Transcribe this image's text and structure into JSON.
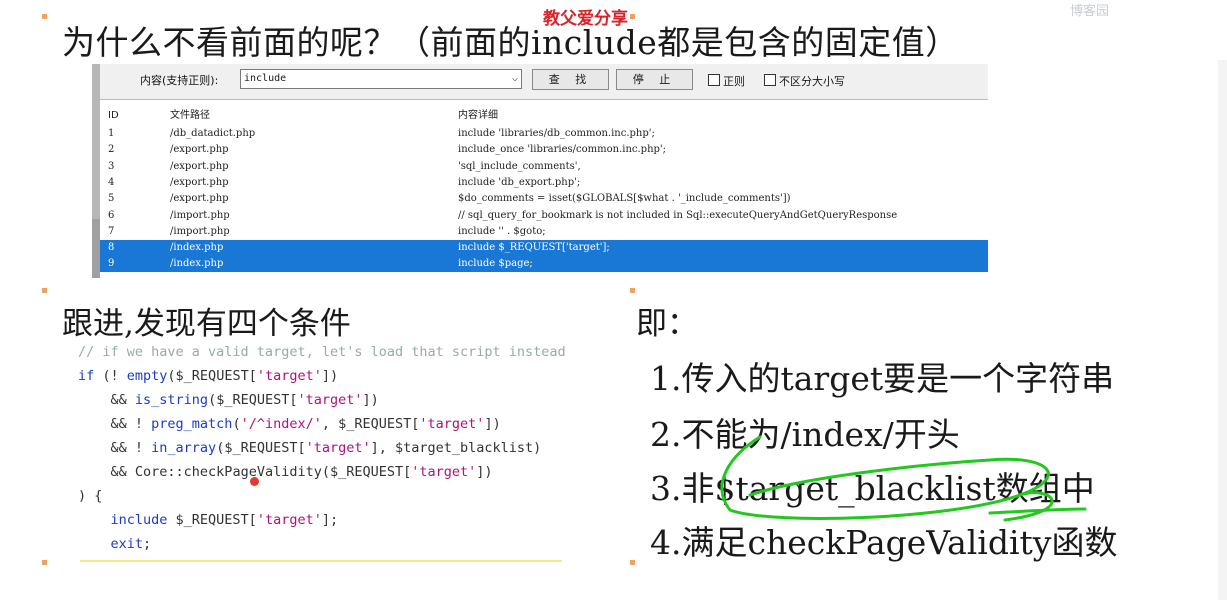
{
  "watermark": "教父爱分享",
  "logo": "博客园",
  "heading": "为什么不看前面的呢？（前面的include都是包含的固定值）",
  "search_tool": {
    "content_label": "内容(支持正则):",
    "query_value": "include",
    "find_button": "查 找",
    "stop_button": "停 止",
    "regex_checkbox": "正则",
    "case_checkbox": "不区分大小写",
    "columns": [
      "ID",
      "文件路径",
      "内容详细"
    ],
    "rows": [
      {
        "id": "1",
        "path": "/db_datadict.php",
        "detail": "include 'libraries/db_common.inc.php';"
      },
      {
        "id": "2",
        "path": "/export.php",
        "detail": "include_once 'libraries/common.inc.php';"
      },
      {
        "id": "3",
        "path": "/export.php",
        "detail": "'sql_include_comments',"
      },
      {
        "id": "4",
        "path": "/export.php",
        "detail": "include 'db_export.php';"
      },
      {
        "id": "5",
        "path": "/export.php",
        "detail": "$do_comments = isset($GLOBALS[$what . '_include_comments'])"
      },
      {
        "id": "6",
        "path": "/import.php",
        "detail": "// sql_query_for_bookmark is not included in Sql::executeQueryAndGetQueryResponse"
      },
      {
        "id": "7",
        "path": "/import.php",
        "detail": "include '' . $goto;"
      },
      {
        "id": "8",
        "path": "/index.php",
        "detail": "include $_REQUEST['target'];",
        "selected": true
      },
      {
        "id": "9",
        "path": "/index.php",
        "detail": "include $page;",
        "selected": true
      }
    ]
  },
  "section_left_title": "跟进,发现有四个条件",
  "section_right_title": "即：",
  "code": {
    "comment": "// if we have a valid target, let's load that script instead",
    "l1": {
      "kw": "if",
      "a": " (! ",
      "fn": "empty",
      "b": "($_REQUEST[",
      "s": "'target'",
      "c": "])"
    },
    "l2": {
      "a": "    && ",
      "fn": "is_string",
      "b": "($_REQUEST[",
      "s": "'target'",
      "c": "])"
    },
    "l3": {
      "a": "    && ! ",
      "fn": "preg_match",
      "b": "(",
      "s1": "'/^index/'",
      "m": ", $_REQUEST[",
      "s": "'target'",
      "c": "])"
    },
    "l4": {
      "a": "    && ! ",
      "fn": "in_array",
      "b": "($_REQUEST[",
      "s": "'target'",
      "c": "], $target_blacklist)"
    },
    "l5": {
      "a": "    && Core::",
      "fn": "checkPageValidity",
      "b": "($_REQUEST[",
      "s": "'target'",
      "c": "])"
    },
    "l6": ") {",
    "l7": {
      "kw": "    include",
      "b": " $_REQUEST[",
      "s": "'target'",
      "c": "];"
    },
    "l8": {
      "kw": "    exit",
      "c": ";"
    }
  },
  "conditions": [
    "1.传入的target要是一个字符串",
    "2.不能为/index/开头",
    "3.非$target_blacklist数组中",
    "4.满足checkPageValidity函数"
  ],
  "colors": {
    "selection": "#1978d6",
    "annotation_green": "#22c81e",
    "watermark": "#d8232a"
  }
}
